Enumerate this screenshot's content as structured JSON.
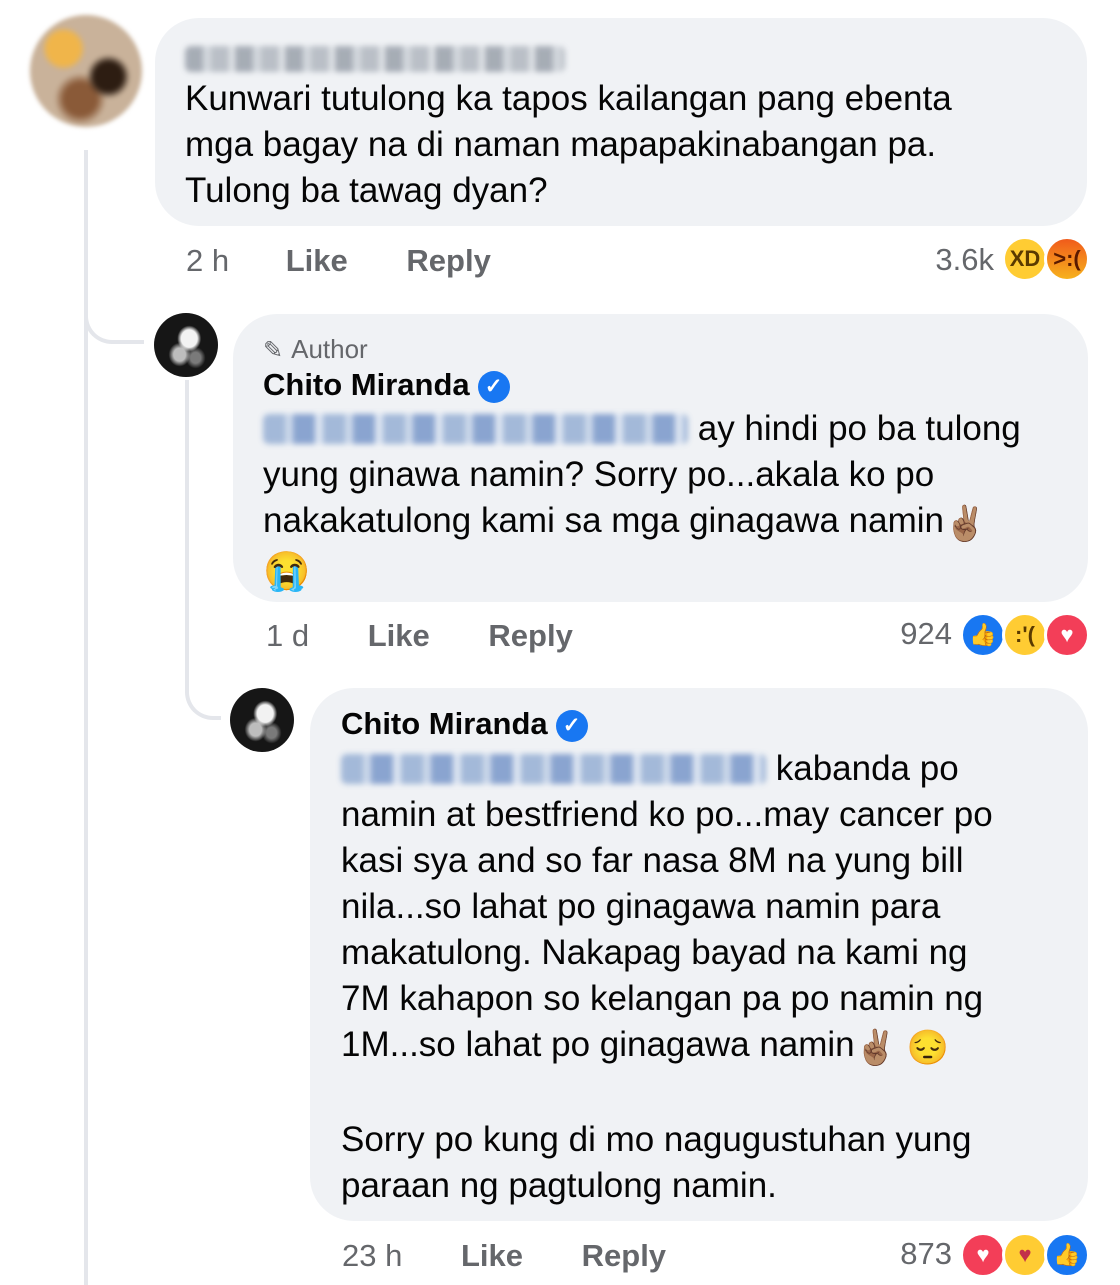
{
  "comments": [
    {
      "text_lines": [
        "Kunwari tutulong ka tapos kailangan pang ebenta",
        "mga bagay na di naman mapapakinabangan pa.",
        "Tulong ba tawag dyan?"
      ],
      "time": "2 h",
      "like_label": "Like",
      "reply_label": "Reply",
      "reaction_count": "3.6k",
      "reactions": [
        "haha-icon",
        "angry-icon"
      ]
    },
    {
      "author_tag": "Author",
      "author_name": "Chito Miranda",
      "text_first_rest": "ay hindi po ba tulong",
      "text_lines": [
        "yung ginawa namin? Sorry po...akala ko po",
        "nakakatulong kami sa mga ginagawa namin"
      ],
      "emoji_victory": "✌🏽",
      "emoji_cry": "😭",
      "time": "1 d",
      "like_label": "Like",
      "reply_label": "Reply",
      "reaction_count": "924",
      "reactions": [
        "like-icon",
        "sad-icon",
        "love-icon"
      ]
    },
    {
      "author_name": "Chito Miranda",
      "text_first_rest": "kabanda po",
      "text_lines": [
        "namin at bestfriend ko po...may cancer po",
        "kasi sya and so far nasa 8M na yung bill",
        "nila...so lahat po ginagawa namin para",
        "makatulong. Nakapag bayad na kami ng",
        "7M kahapon so kelangan pa po namin ng",
        "1M...so lahat po ginagawa namin"
      ],
      "emoji_victory": "✌🏽",
      "emoji_pensive": "😔",
      "text_lines_2": [
        "Sorry po kung di mo nagugustuhan yung",
        "paraan ng pagtulong namin."
      ],
      "time": "23 h",
      "like_label": "Like",
      "reply_label": "Reply",
      "reaction_count": "873",
      "reactions": [
        "love-icon",
        "care-icon",
        "like-icon"
      ]
    }
  ]
}
